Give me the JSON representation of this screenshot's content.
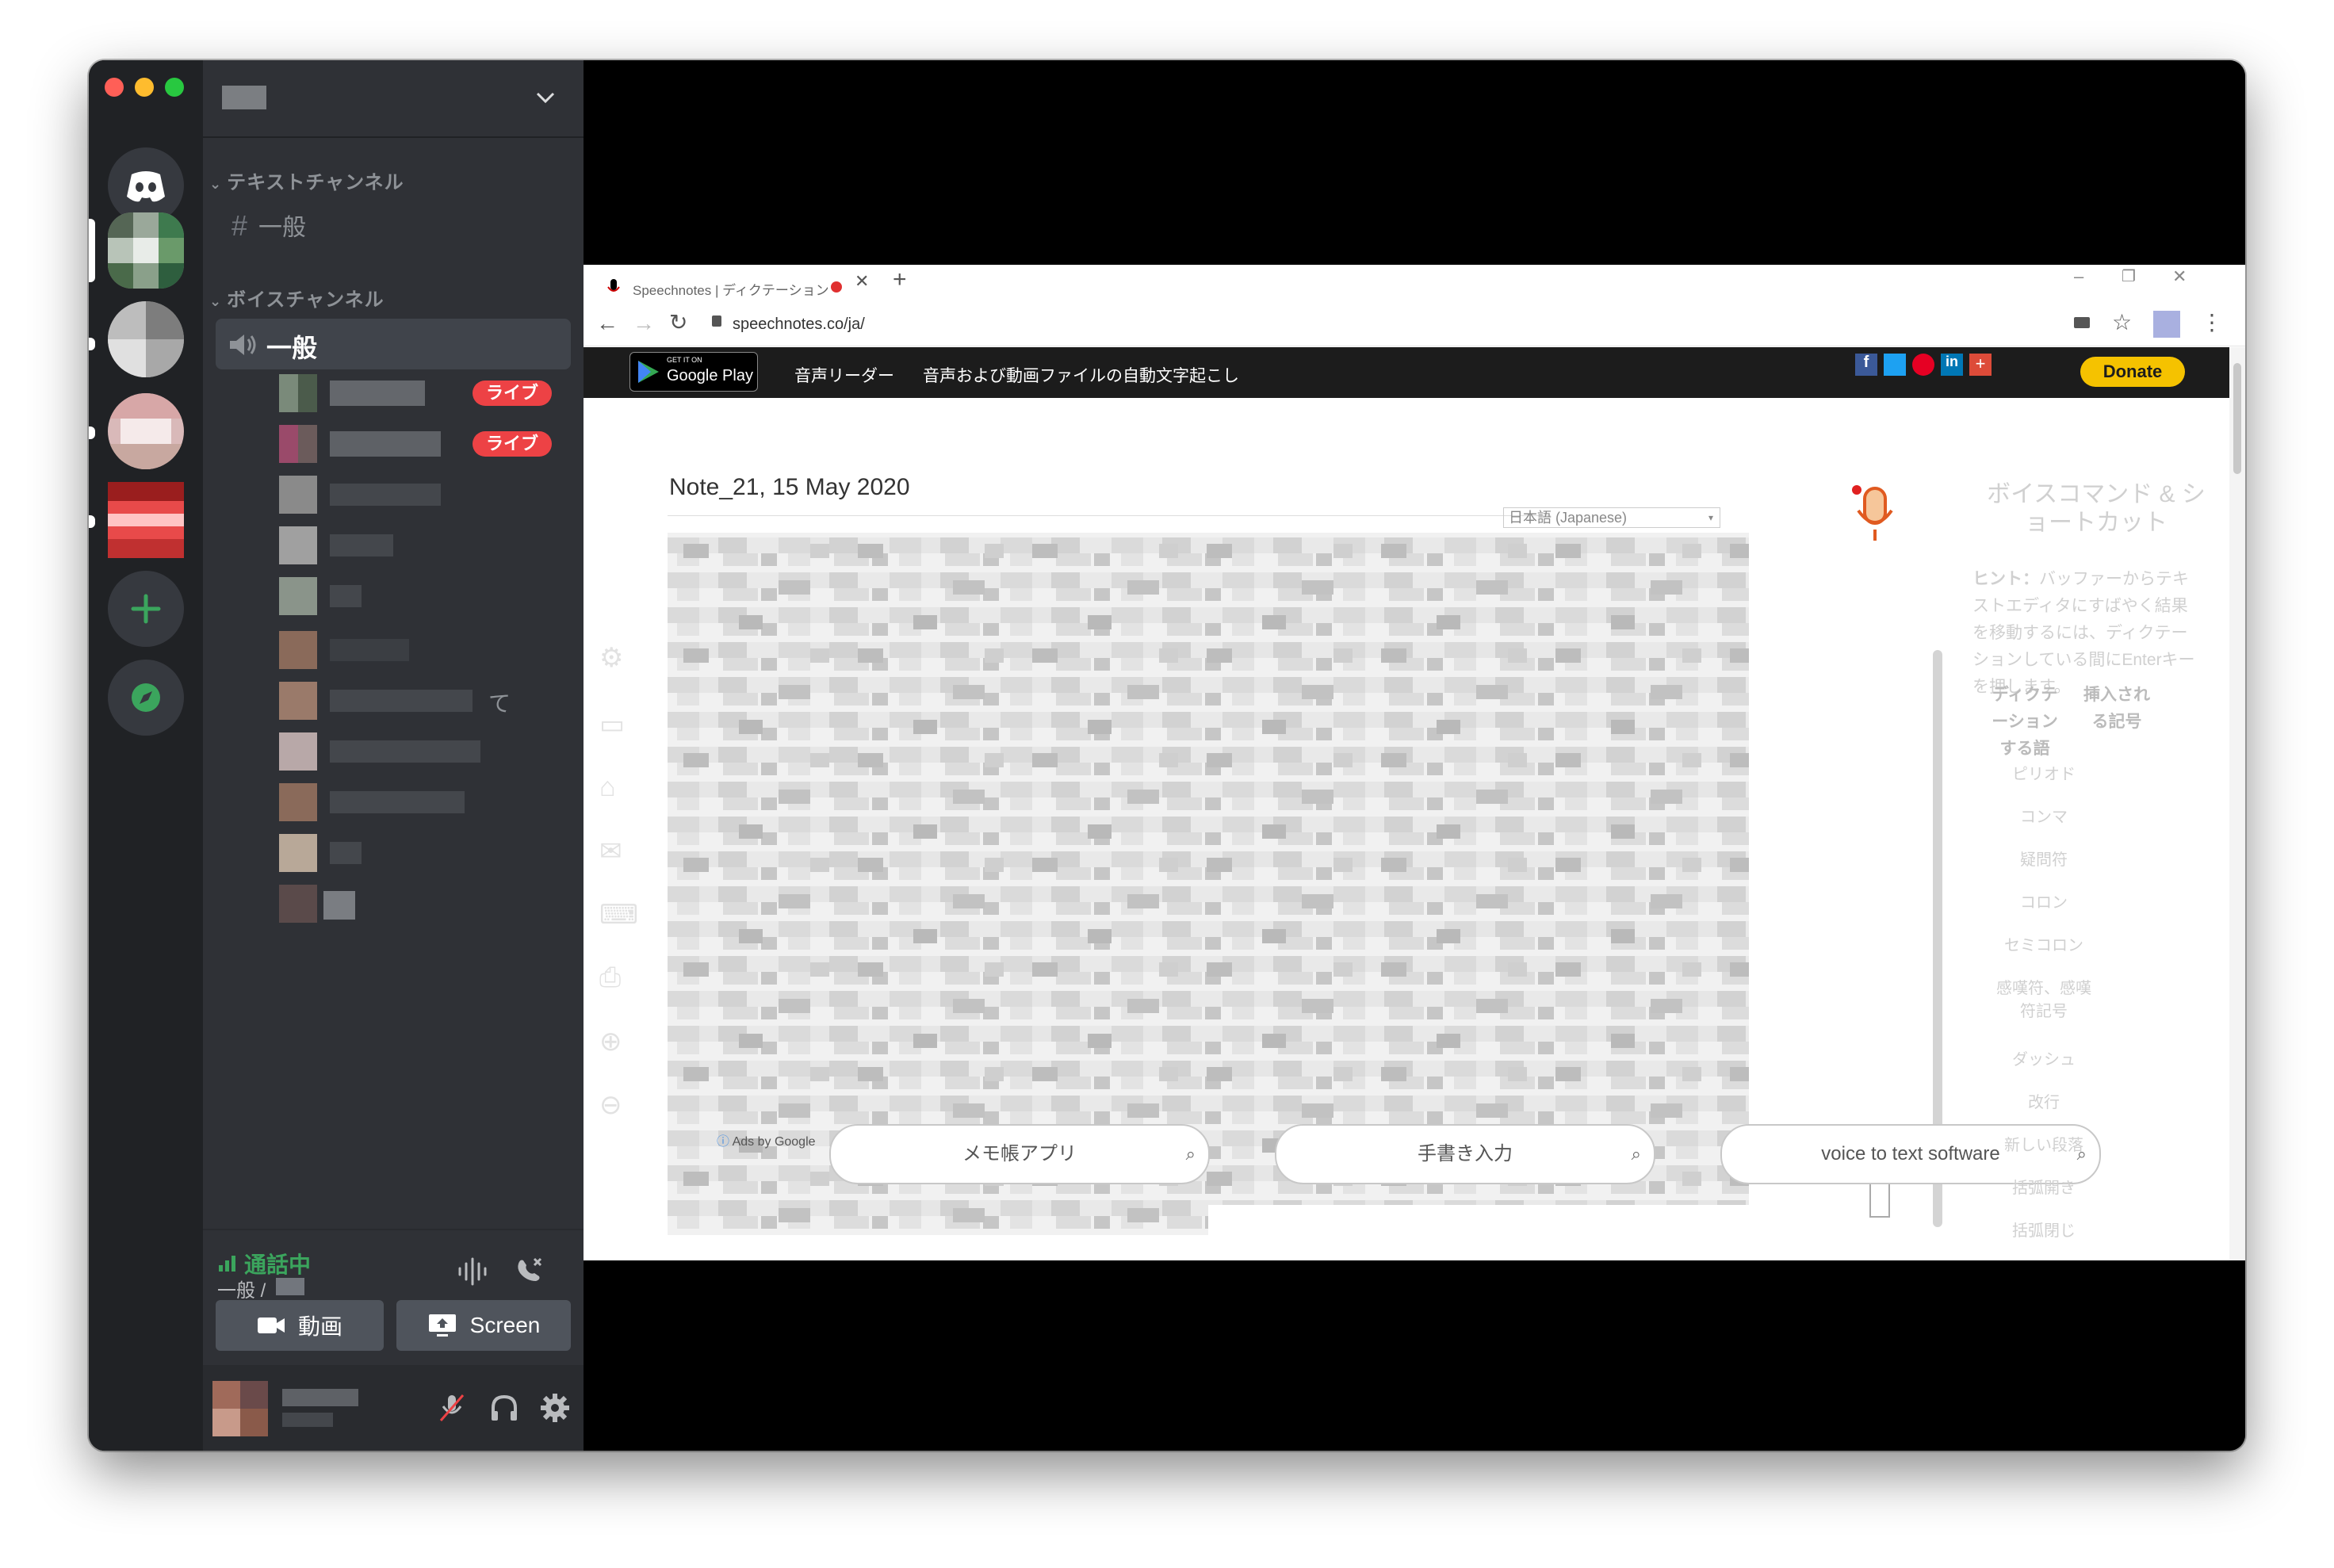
{
  "colors": {
    "discord_bg": "#2f3136",
    "rail_bg": "#202225",
    "live_red": "#ed4245",
    "connected_green": "#3ba55d",
    "blurple": "#5865f2",
    "donate_yellow": "#f5c200"
  },
  "discord": {
    "text_category": "テキストチャンネル",
    "text_channel": "一般",
    "voice_category": "ボイスチャンネル",
    "voice_channel": "一般",
    "live_badge": "ライブ",
    "live_badge_2": "ライブ",
    "user_suffix": "て",
    "voice_status": {
      "label": "通話中",
      "location": "一般 /"
    },
    "buttons": {
      "video": "動画",
      "screen": "Screen"
    }
  },
  "browser": {
    "tab_title": "Speechnotes | ディクテーション",
    "url": "speechnotes.co/ja/",
    "site_nav": {
      "store_small": "GET IT ON",
      "store": "Google Play",
      "link1": "音声リーダー",
      "link2": "音声および動画ファイルの自動文字起こし",
      "donate": "Donate"
    },
    "note_title": "Note_21, 15 May 2020",
    "language_select": "日本語 (Japanese)",
    "ads_label": "Ads by Google",
    "searches": [
      "メモ帳アプリ",
      "手書き入力",
      "voice to text software"
    ],
    "right_panel": {
      "title": "ボイスコマンド & ショートカット",
      "hint_label": "ヒント：",
      "hint_text": "バッファーからテキストエディタにすばやく結果を移動するには、ディクテーションしている間にEnterキーを押します。",
      "col1": "ディクテーションする語",
      "col2": "挿入される記号",
      "rows": [
        "ピリオド",
        "コンマ",
        "疑問符",
        "コロン",
        "セミコロン",
        "感嘆符、感嘆符記号",
        "ダッシュ",
        "改行",
        "新しい段落",
        "括弧開き",
        "括弧閉じ"
      ]
    }
  }
}
